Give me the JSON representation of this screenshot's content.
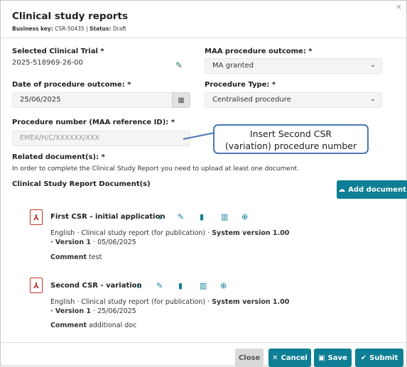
{
  "modal": {
    "title": "Clinical study reports",
    "business_key_label": "Business key:",
    "business_key": "CSR-50435",
    "separator": "|",
    "status_label": "Status:",
    "status": "Draft",
    "close_glyph": "×"
  },
  "form": {
    "trial_label": "Selected Clinical Trial *",
    "trial_value": "2025-518969-26-00",
    "maa_outcome_label": "MAA procedure outcome: *",
    "maa_outcome_value": "MA granted",
    "date_label": "Date of procedure outcome: *",
    "date_value": "25/06/2025",
    "procedure_type_label": "Procedure Type: *",
    "procedure_type_value": "Centralised procedure",
    "procedure_number_label": "Procedure number (MAA reference ID): *",
    "procedure_number_placeholder": "EMEA/H/C/XXXXXX/XXX",
    "related_docs_label": "Related document(s): *",
    "related_docs_help": "In order to complete the Clinical Study Report you need to upload at least one document.",
    "csr_docs_label": "Clinical Study Report Document(s)"
  },
  "callout": {
    "line1": "Insert Second CSR",
    "line2": "(variation) procedure number"
  },
  "add_document_label": "Add document",
  "documents": [
    {
      "title": "First CSR - initial application",
      "meta_prefix": "English · Clinical study report (for publication) ·",
      "system_version": "System version 1.00",
      "version": "· Version 1",
      "date": "· 05/06/2025",
      "comment_label": "Comment",
      "comment": "test"
    },
    {
      "title": "Second CSR - variation",
      "meta_prefix": "English · Clinical study report (for publication) ·",
      "system_version": "System version 1.00",
      "version": "· Version 1",
      "date": "· 25/06/2025",
      "comment_label": "Comment",
      "comment": "additional doc"
    }
  ],
  "footer": {
    "close_label": "Close",
    "cancel_label": "Cancel",
    "save_label": "Save",
    "submit_label": "Submit"
  },
  "colors": {
    "teal": "#0e7f94",
    "pdf_red": "#c0392b",
    "callout_border": "#4a78b5"
  }
}
